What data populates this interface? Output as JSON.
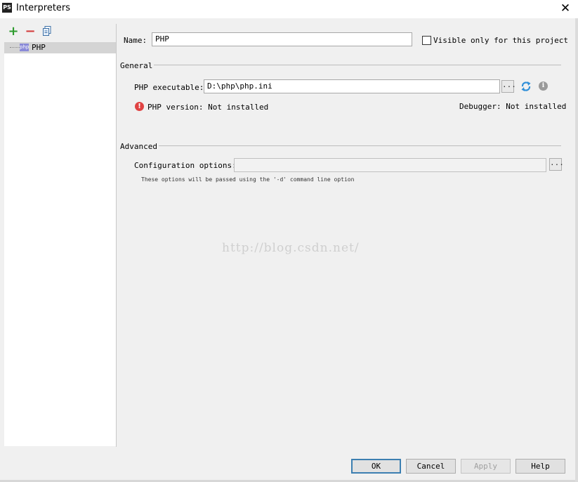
{
  "window": {
    "title": "Interpreters",
    "app_icon_text": "PS",
    "close_symbol": "✕"
  },
  "toolbar": {
    "add_symbol": "+",
    "remove_symbol": "−",
    "copy_icon": "copy-icon"
  },
  "tree": {
    "items": [
      {
        "icon_text": "php",
        "label": "PHP",
        "selected": true
      }
    ]
  },
  "form": {
    "name_label": "Name:",
    "name_value": "PHP",
    "visible_only_label": "Visible only for this project",
    "visible_only_checked": false,
    "general_label": "General",
    "php_exec_label": "PHP executable:",
    "php_exec_value": "D:\\php\\php.ini",
    "browse_label": "...",
    "php_version_text": "PHP version: Not installed",
    "debugger_text": "Debugger: Not installed",
    "error_icon_text": "!",
    "info_icon_text": "i",
    "advanced_label": "Advanced",
    "config_label": "Configuration options:",
    "config_value": "",
    "config_hint": "These options will be passed using the '-d' command line option"
  },
  "watermark": "http://blog.csdn.net/",
  "buttons": {
    "ok": "OK",
    "cancel": "Cancel",
    "apply": "Apply",
    "help": "Help"
  },
  "colors": {
    "accent": "#3c7fb1",
    "add_green": "#2e9b2e",
    "remove_red": "#d33b3b",
    "error_red": "#e04343",
    "refresh_blue": "#2f8fd8"
  }
}
